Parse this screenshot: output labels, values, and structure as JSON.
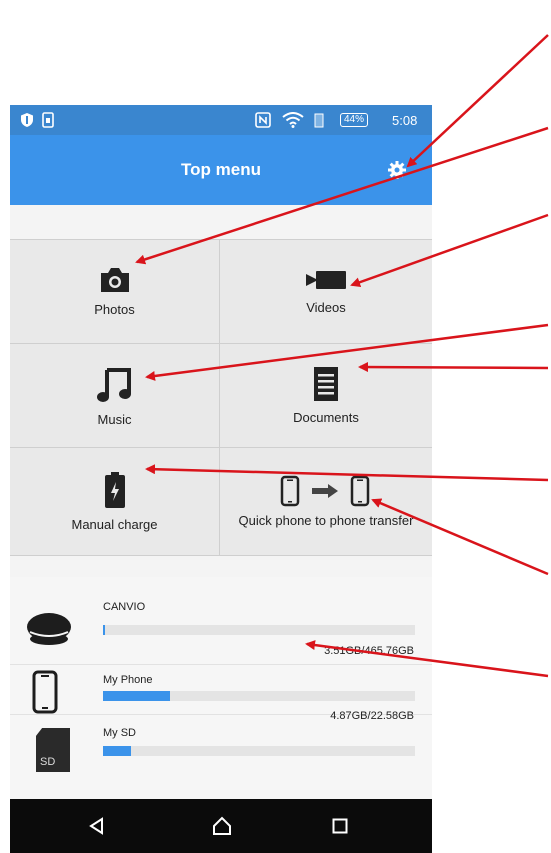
{
  "status_bar": {
    "battery_percent": "44%",
    "time": "5:08"
  },
  "app_bar": {
    "title": "Top menu",
    "settings_icon": "gear-icon"
  },
  "tiles": [
    {
      "label": "Photos",
      "icon": "camera-icon"
    },
    {
      "label": "Videos",
      "icon": "video-camera-icon"
    },
    {
      "label": "Music",
      "icon": "music-note-icon"
    },
    {
      "label": "Documents",
      "icon": "document-icon"
    },
    {
      "label": "Manual charge",
      "icon": "battery-charge-icon"
    },
    {
      "label": "Quick phone to phone transfer",
      "icon": "phone-transfer-icon"
    }
  ],
  "storage": [
    {
      "name": "CANVIO",
      "usage": "3.51GB/465.76GB",
      "fill_fraction": 0.0075,
      "icon": "external-drive-icon"
    },
    {
      "name": "My Phone",
      "usage": "4.87GB/22.58GB",
      "fill_fraction": 0.216,
      "icon": "phone-icon"
    },
    {
      "name": "My SD",
      "usage": "",
      "fill_fraction": 0.09,
      "icon": "sd-card-icon",
      "icon_text": "SD"
    }
  ],
  "colors": {
    "accent": "#3b93ea",
    "status_bar": "#3a86cf",
    "annotation_arrows": "#d9141b"
  }
}
